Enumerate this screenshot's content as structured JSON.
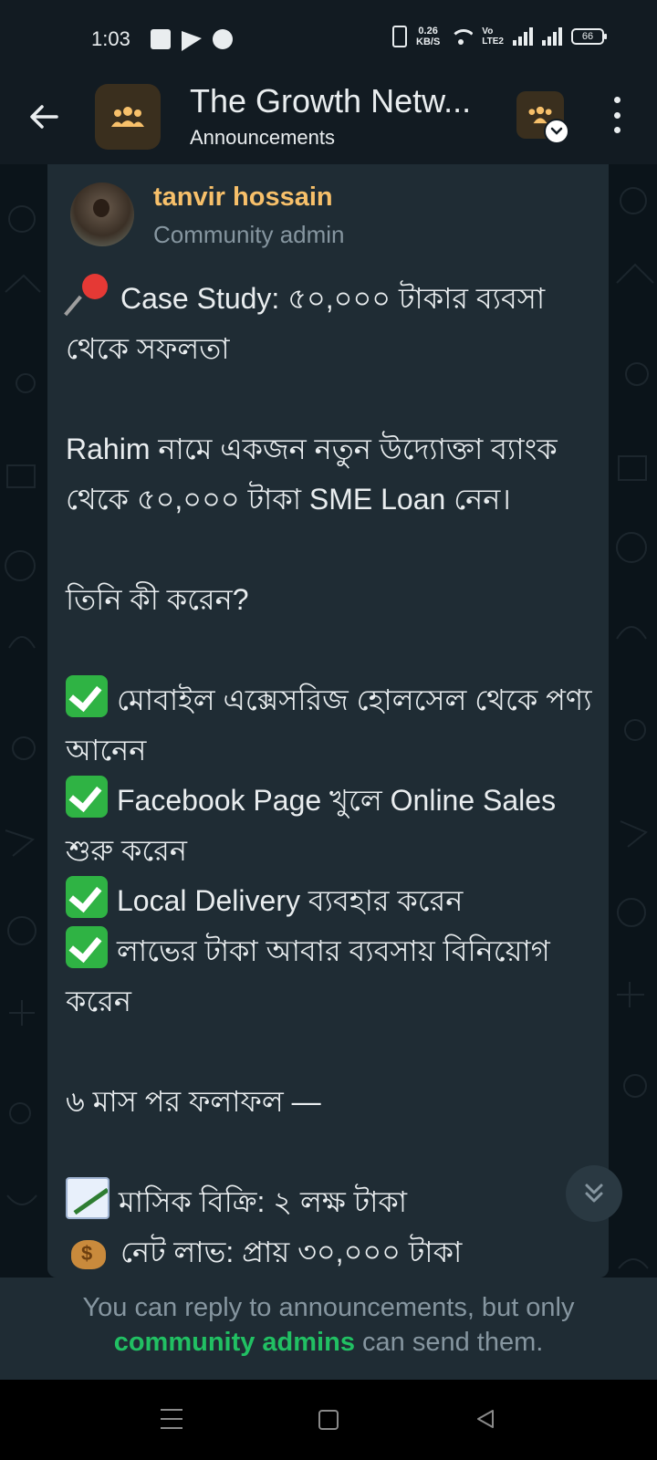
{
  "status_bar": {
    "time": "1:03",
    "net_speed_value": "0.26",
    "net_speed_unit": "KB/S",
    "volte_top": "Vo",
    "volte_bottom": "LTE2",
    "battery": "66"
  },
  "header": {
    "title": "The Growth Netw...",
    "subtitle": "Announcements"
  },
  "message": {
    "sender_name": "tanvir hossain",
    "sender_role": "Community admin",
    "lines": [
      "Case Study: ৫০,০০০ টাকার ব্যবসা থেকে সফলতা",
      "Rahim নামে একজন নতুন উদ্যোক্তা ব্যাংক থেকে ৫০,০০০ টাকা SME Loan নেন।",
      "তিনি কী করেন?",
      "মোবাইল এক্সেসরিজ হোলসেল থেকে পণ্য আনেন",
      "Facebook Page খুলে Online Sales শুরু করেন",
      "Local Delivery ব্যবহার করেন",
      "লাভের টাকা আবার ব্যবসায় বিনিয়োগ করেন",
      "৬ মাস পর ফলাফল —",
      "মাসিক বিক্রি: ২ লক্ষ টাকা",
      "নেট লাভ: প্রায় ৩০,০০০ টাকা"
    ]
  },
  "footer": {
    "notice_prefix": "You can reply to announcements, but only",
    "notice_link": "community admins",
    "notice_suffix": " can send them."
  },
  "colors": {
    "background": "#0b141a",
    "bubble": "#1f2c34",
    "sender_name": "#f7c06a",
    "link": "#21c063"
  }
}
